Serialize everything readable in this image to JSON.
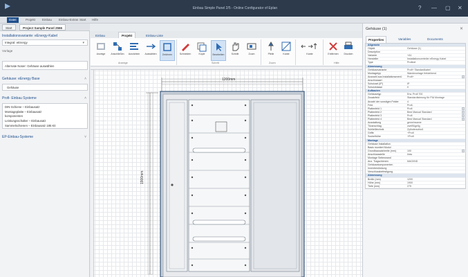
{
  "window": {
    "title": "Einbau Simple Panel 2/5 - Online Configurator of Eplan",
    "controls": [
      "?",
      "—",
      "▢",
      "✕"
    ]
  },
  "menu": [
    "Datei",
    "Projekt",
    "Einbau",
    "Einbau-Extras",
    "Start",
    "Hilfe"
  ],
  "tabs": [
    "Start",
    "Project Sample Panel 2566"
  ],
  "left_panel": {
    "header": "Installationsvariante: eEnergy-Kabel",
    "selector": "Vorlage",
    "combo_value": "Integral: eEnergy",
    "section_label": "Schaltanlage",
    "list_item": "Alternate Noser: Gehäuse auswählen",
    "cabinet_header": "Gehäuse: eEnergy Base",
    "cabinet_value": "Gehäuse",
    "profi_header": "Profi- Einbau Systeme",
    "profi_items": [
      "DIN-Schiene – Einbausatz",
      "Montageplatte – Einbausatz",
      "komponenten",
      "Leistungsschalter – Einbausatz",
      "Sammelschienen – Einbausatz 185 Kit"
    ],
    "ep_header": "EP-Einbau-Systeme"
  },
  "ribbon": {
    "tabs": [
      "Einbau",
      "Projekt",
      "Einbau-Liste"
    ],
    "buttons": [
      "Anzeige",
      "Anschließen",
      "Ausrichten",
      "Auswählen",
      "Zeichnen",
      "Schneiden",
      "Kopie",
      "Bearbeiten",
      "Schnitt",
      "Zoom",
      "Pfeile",
      "Kante",
      "Entfernen",
      "Drucken",
      "Speichern"
    ],
    "groups": [
      "Anzeige",
      "Zeichnen",
      "Schritt",
      "Zoom",
      "Kante",
      "Hilfe"
    ]
  },
  "canvas": {
    "width_label": "1200mm",
    "height_label": "1900mm"
  },
  "right_panel": {
    "title": "Gehäuse (1)",
    "tabs": [
      "Properties",
      "Variables",
      "Documents"
    ],
    "properties": [
      {
        "k": "Allgemein",
        "v": "",
        "cat": true
      },
      {
        "k": "Objekt",
        "v": "Gehäuse (1)"
      },
      {
        "k": "Description",
        "v": ""
      },
      {
        "k": "Variante",
        "v": "+A1"
      },
      {
        "k": "Hersteller",
        "v": "Installationsverteiler eEnergy Kabel"
      },
      {
        "k": "Type",
        "v": "Profinet"
      },
      {
        "k": "Abmessung",
        "v": "",
        "cat": true
      },
      {
        "k": "Gehäusevariante",
        "v": "Profi+ Standardkabel"
      },
      {
        "k": "Montagetyp",
        "v": "Wandmontage freistehend"
      },
      {
        "k": "Auswahl aus Installationsmenü",
        "v": "Profi+"
      },
      {
        "k": "Anschlussart",
        "v": ""
      },
      {
        "k": "Schutzart (IP)",
        "v": "IP"
      },
      {
        "k": "Schutzklasse",
        "v": "II"
      },
      {
        "k": "Aufbauten",
        "v": "",
        "cat": true
      },
      {
        "k": "Gehäusetyp",
        "v": "Erw. Profi 700"
      },
      {
        "k": "Zusatzfeld",
        "v": "Standardisierung für PIA Montage"
      },
      {
        "k": "Anzahl der sonstigen Felder",
        "v": "4"
      },
      {
        "k": "Feld",
        "v": "Profi-"
      },
      {
        "k": "Plattenfeld 1",
        "v": "Profi"
      },
      {
        "k": "Plattenfeld 2",
        "v": "Best Manual Standard"
      },
      {
        "k": "Plattenfeld 3",
        "v": "Profi"
      },
      {
        "k": "Plattenfeld 4",
        "v": "Best Manual Standard"
      },
      {
        "k": "Ausstattung",
        "v": "gemeinsame"
      },
      {
        "k": "Türanschlag",
        "v": "zweiflügelig"
      },
      {
        "k": "Schließtechnik",
        "v": "Zylinderschloß"
      },
      {
        "k": "Griffe",
        "v": "+Profi"
      },
      {
        "k": "Sockelhöhe",
        "v": "+Profi"
      },
      {
        "k": "Montage",
        "v": "",
        "cat": true
      },
      {
        "k": "Gehäuse Installation",
        "v": ""
      },
      {
        "k": "Basis montiert Modul",
        "v": ""
      },
      {
        "k": "Grundbausatzbreite (mm)",
        "v": "100"
      },
      {
        "k": "Anschlussstelle",
        "v": "links"
      },
      {
        "k": "Montage Seitenwand",
        "v": ""
      },
      {
        "k": "Anz. Tragschienen",
        "v": "MAG/IND"
      },
      {
        "k": "Gehäusekomponenten",
        "v": ""
      },
      {
        "k": "Innenbestückung",
        "v": ""
      },
      {
        "k": "Verschlussbefestigung",
        "v": ""
      },
      {
        "k": "Abmessung",
        "v": "",
        "cat": true
      },
      {
        "k": "Breite (mm)",
        "v": "1200"
      },
      {
        "k": "Höhe (mm)",
        "v": "1900"
      },
      {
        "k": "Tiefe (mm)",
        "v": "275"
      }
    ]
  }
}
